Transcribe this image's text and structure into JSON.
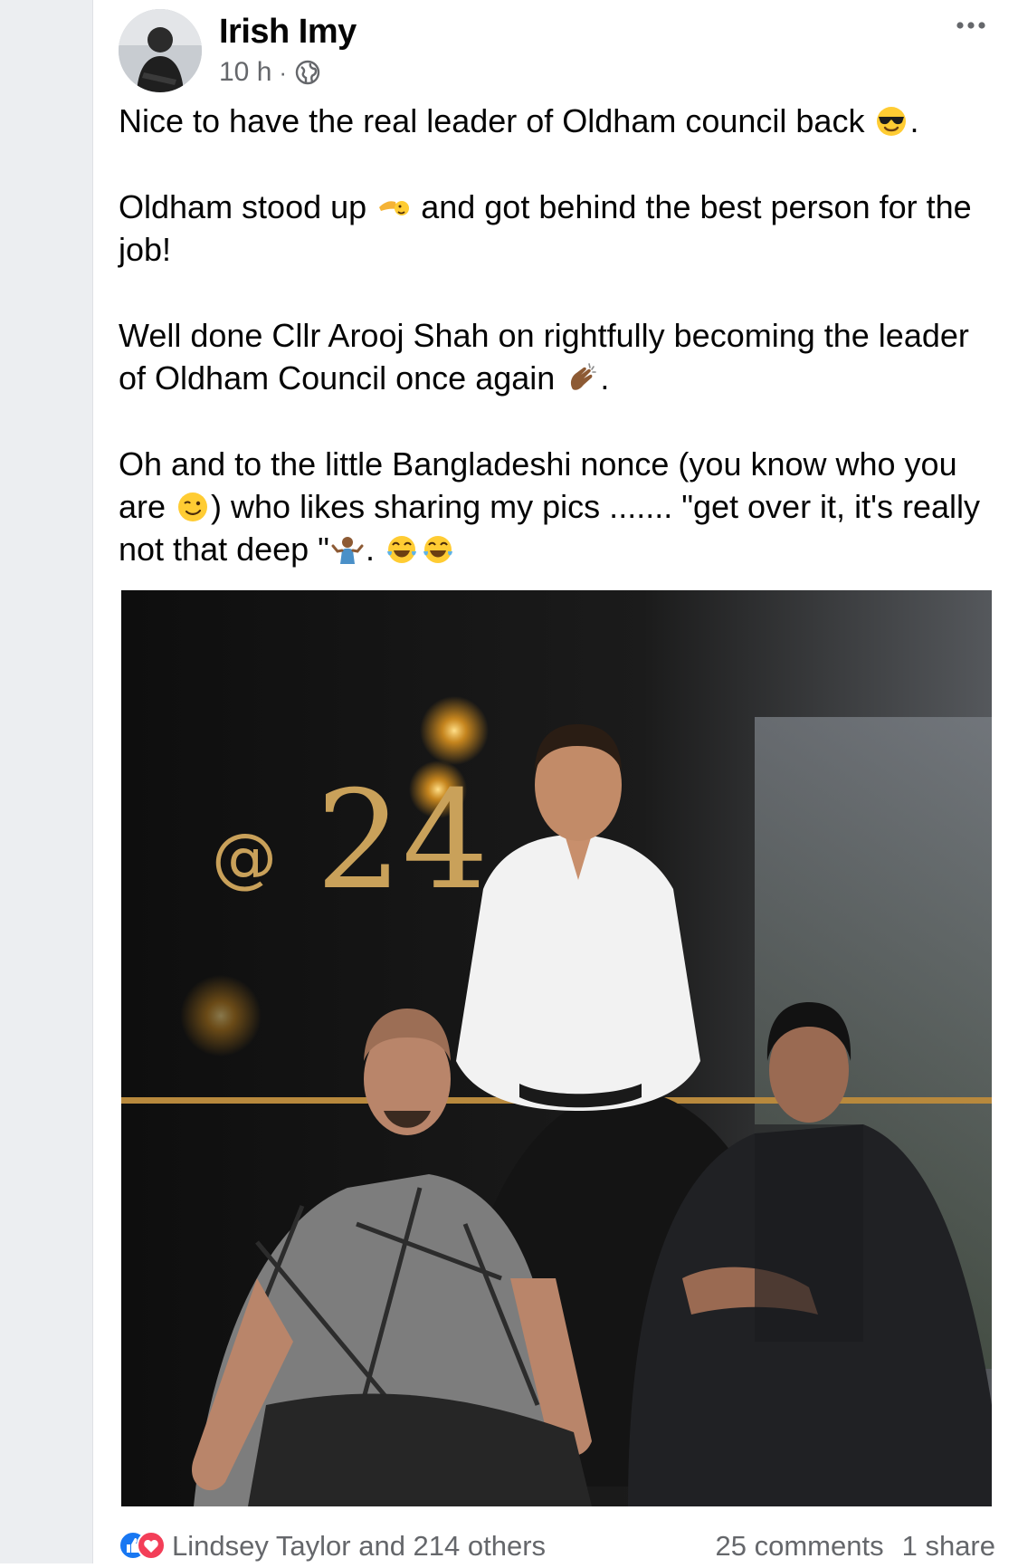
{
  "post": {
    "author": "Irish Imy",
    "time": "10 h",
    "separator": "·",
    "privacy_icon": "globe-icon",
    "menu_icon": "more-horizontal-icon",
    "paragraphs": [
      {
        "text": "Nice to have the real leader of Oldham council back",
        "trailing_emoji": "smiling-sunglasses-emoji",
        "tail": "."
      },
      {
        "text": "Oldham stood up",
        "mid_emoji": "saluting-hand-emoji",
        "text2": "and got behind the best person for the job!"
      },
      {
        "text": "Well done Cllr Arooj Shah on rightfully becoming the leader of Oldham Council once again",
        "trailing_emoji": "clapping-hands-emoji",
        "tail": "."
      },
      {
        "text": "Oh and to the little Bangladeshi  nonce (you know who you are",
        "mid_emoji": "winking-face-emoji",
        "text2": ") who likes sharing my pics ....... \"get over it, it's really not that deep \"",
        "trailing_emoji": "person-shrugging-emoji",
        "tail": ".",
        "end_emojis": [
          "tears-of-joy-emoji",
          "tears-of-joy-emoji"
        ]
      }
    ],
    "photo": {
      "sign_text": "@24",
      "description_icon": "photo-image"
    }
  },
  "footer": {
    "reaction_icons": [
      "like-reaction-icon",
      "love-reaction-icon"
    ],
    "likers": "Lindsey Taylor and 214 others",
    "comments": "25 comments",
    "shares": "1 share"
  },
  "colors": {
    "secondary_text": "#65676b",
    "like_blue": "#1877f2",
    "love_red": "#f33e58",
    "gold": "#c9a15a"
  }
}
